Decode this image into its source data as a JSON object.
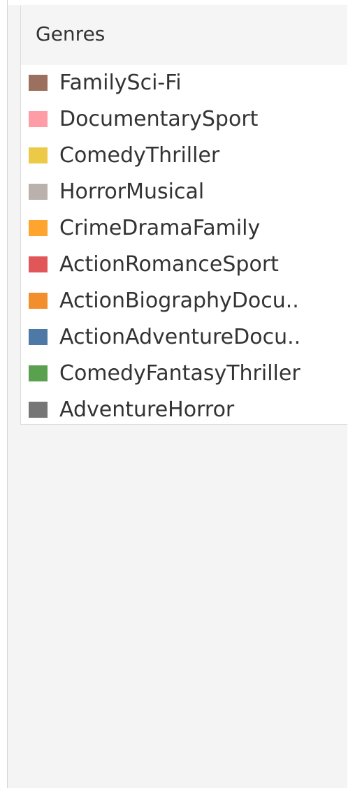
{
  "legend": {
    "title": "Genres",
    "items": [
      {
        "label": "FamilySci-Fi",
        "color": "#9c705e"
      },
      {
        "label": "DocumentarySport",
        "color": "#ff9da7"
      },
      {
        "label": "ComedyThriller",
        "color": "#edc948"
      },
      {
        "label": "HorrorMusical",
        "color": "#bab0ac"
      },
      {
        "label": "CrimeDramaFamily",
        "color": "#ffa52f"
      },
      {
        "label": "ActionRomanceSport",
        "color": "#e15759"
      },
      {
        "label": "ActionBiographyDocu..",
        "color": "#f28e2b"
      },
      {
        "label": "ActionAdventureDocu..",
        "color": "#4e79a7"
      },
      {
        "label": "ComedyFantasyThriller",
        "color": "#59a14f"
      },
      {
        "label": "AdventureHorror",
        "color": "#767676"
      }
    ]
  }
}
